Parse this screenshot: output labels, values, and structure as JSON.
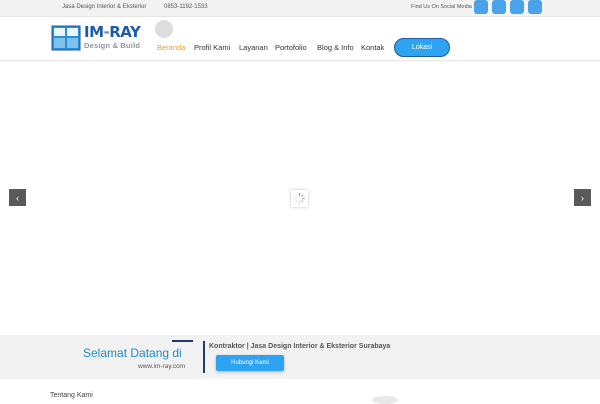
{
  "topbar": {
    "tagline": "Jasa Design Interior & Eksterior",
    "phone": "0853-1192-1533",
    "social_text": "Find Us On Social Media",
    "social_icons": [
      "facebook-icon",
      "twitter-icon",
      "instagram-icon",
      "youtube-icon"
    ],
    "social_color": "#4aa3e8"
  },
  "header": {
    "brand_main": "IM",
    "brand_dash": "-",
    "brand_rest": "RAY",
    "brand_sub": "Design & Build",
    "nav": [
      {
        "label": "Beranda",
        "active": true
      },
      {
        "label": "Profil Kami",
        "active": false
      },
      {
        "label": "Layanan",
        "active": false
      },
      {
        "label": "Portofolio",
        "active": false
      },
      {
        "label": "Blog & Info",
        "active": false
      },
      {
        "label": "Kontak",
        "active": false
      }
    ],
    "lokasi_label": "Lokasi",
    "active_color": "#e2a12e",
    "brand_color": "#1e5aa8"
  },
  "slider": {
    "prev_icon": "chevron-left-icon",
    "next_icon": "chevron-right-icon",
    "prev_glyph": "‹",
    "next_glyph": "›"
  },
  "welcome": {
    "title": "Selamat Datang di",
    "url": "www.im-ray.com",
    "description": "Kontraktor | Jasa Design Interior & Eksterior Surabaya",
    "button_label": "Hubungi Kami",
    "accent_color": "#2ea3f2"
  },
  "section": {
    "title": "Tentang Kami"
  }
}
